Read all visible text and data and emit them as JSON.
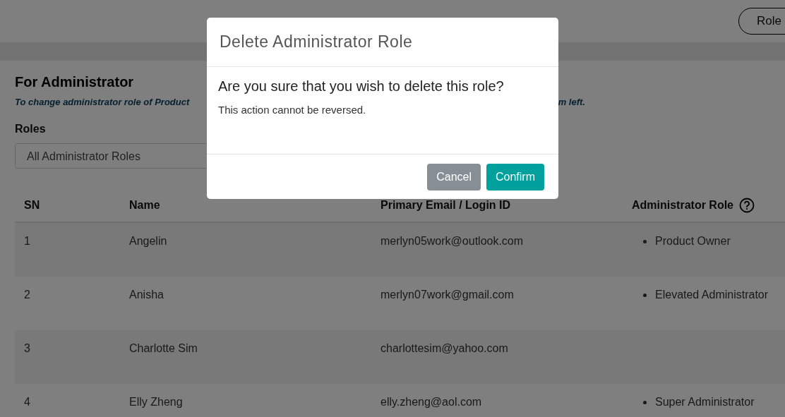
{
  "header": {
    "button": "Role"
  },
  "section": {
    "title": "For Administrator",
    "note_start": "To change administrator role of Product",
    "note_end": "m left."
  },
  "roles_filter": {
    "label": "Roles",
    "value": "All Administrator Roles"
  },
  "table": {
    "columns": [
      "SN",
      "Name",
      "Primary Email / Login ID",
      "Administrator Role"
    ],
    "rows": [
      {
        "sn": "1",
        "name": "Angelin",
        "email": "merlyn05work@outlook.com",
        "roles": [
          "Product Owner"
        ]
      },
      {
        "sn": "2",
        "name": "Anisha",
        "email": "merlyn07work@gmail.com",
        "roles": [
          "Elevated Administrator"
        ]
      },
      {
        "sn": "3",
        "name": "Charlotte Sim",
        "email": "charlottesim@yahoo.com",
        "roles": []
      },
      {
        "sn": "4",
        "name": "Elly Zheng",
        "email": "elly.zheng@aol.com",
        "roles": [
          "Super Administrator"
        ]
      }
    ]
  },
  "modal": {
    "title": "Delete Administrator Role",
    "question": "Are you sure that you wish to delete this role?",
    "message": "This action cannot be reversed.",
    "buttons": [
      {
        "label": "Cancel",
        "kind": "secondary"
      },
      {
        "label": "Confirm",
        "kind": "primary"
      }
    ]
  }
}
